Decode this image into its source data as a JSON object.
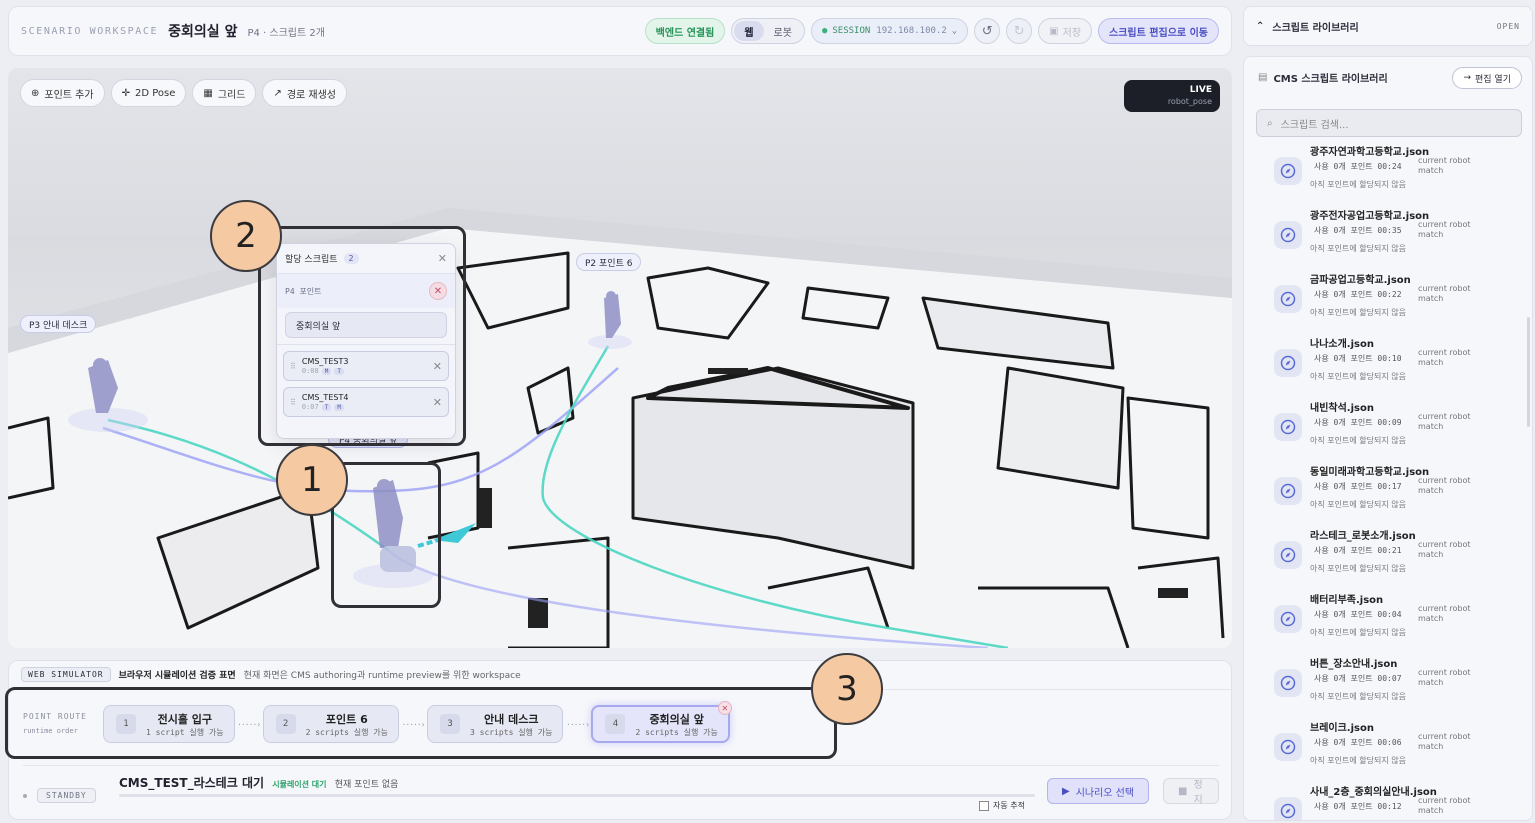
{
  "topbar": {
    "label": "SCENARIO WORKSPACE",
    "title": "중회의실 앞",
    "subtitle": "P4 · 스크립트 2개",
    "backend": "백엔드 연결됨",
    "mode_web": "웹",
    "mode_robot": "로봇",
    "session_label": "SESSION",
    "session_ip": "192.168.100.2",
    "save": "저장",
    "goto_edit": "스크립트 편집으로 이동"
  },
  "toolbar": {
    "add_point": "포인트 추가",
    "pose": "2D Pose",
    "grid": "그리드",
    "regen": "경로 재생성"
  },
  "live": {
    "title": "LIVE",
    "sub": "robot_pose"
  },
  "map_tags": {
    "p3": "P3  안내 데스크",
    "p2": "P2  포인트 6",
    "p4": "P4  중회의실 앞"
  },
  "assign_panel": {
    "title": "할당 스크립트",
    "count": "2",
    "point_label": "P4  포인트",
    "point_name": "중회의실 앞",
    "scripts": [
      {
        "name": "CMS_TEST3",
        "time": "0:08",
        "tags": [
          "M",
          "T"
        ]
      },
      {
        "name": "CMS_TEST4",
        "time": "0:07",
        "tags": [
          "T",
          "M"
        ]
      }
    ]
  },
  "callouts": [
    "1",
    "2",
    "3"
  ],
  "simulator": {
    "tag": "WEB SIMULATOR",
    "title": "브라우저 시뮬레이션 검증 표면",
    "desc": "현재 화면은 CMS authoring과 runtime preview를 위한 workspace"
  },
  "route": {
    "label": "POINT ROUTE",
    "sub": "runtime order",
    "steps": [
      {
        "n": "1",
        "title": "전시홀 입구",
        "desc": "1 script 실행 가능"
      },
      {
        "n": "2",
        "title": "포인트 6",
        "desc": "2 scripts 실행 가능"
      },
      {
        "n": "3",
        "title": "안내 데스크",
        "desc": "3 scripts 실행 가능"
      },
      {
        "n": "4",
        "title": "중회의실 앞",
        "desc": "2 scripts 실행 가능"
      }
    ]
  },
  "status": {
    "state": "STANDBY",
    "scenario": "CMS_TEST_라스테크 대기",
    "sim": "시뮬레이션 대기",
    "point": "현재 포인트 없음",
    "autotrack": "자동 추적",
    "select": "시나리오 선택",
    "stop": "정지"
  },
  "library": {
    "head": "스크립트 라이브러리",
    "open": "OPEN",
    "title": "CMS 스크립트 라이브러리",
    "edit": "편집 열기",
    "search_placeholder": "스크립트 검색...",
    "items": [
      {
        "name": "광주자연과학고등학교.json",
        "meta": "사용 0개 포인트  00:24",
        "cr1": "current robot",
        "cr2": "match",
        "note": "아직 포인트에 할당되지 않음"
      },
      {
        "name": "광주전자공업고등학교.json",
        "meta": "사용 0개 포인트  00:35",
        "cr1": "current robot",
        "cr2": "match",
        "note": "아직 포인트에 할당되지 않음"
      },
      {
        "name": "금파공업고등학교.json",
        "meta": "사용 0개 포인트  00:22",
        "cr1": "current robot",
        "cr2": "match",
        "note": "아직 포인트에 할당되지 않음"
      },
      {
        "name": "나나소개.json",
        "meta": "사용 0개 포인트  00:10",
        "cr1": "current robot",
        "cr2": "match",
        "note": "아직 포인트에 할당되지 않음"
      },
      {
        "name": "내빈착석.json",
        "meta": "사용 0개 포인트  00:09",
        "cr1": "current robot",
        "cr2": "match",
        "note": "아직 포인트에 할당되지 않음"
      },
      {
        "name": "동일미래과학고등학교.json",
        "meta": "사용 0개 포인트  00:17",
        "cr1": "current robot",
        "cr2": "match",
        "note": "아직 포인트에 할당되지 않음"
      },
      {
        "name": "라스테크_로봇소개.json",
        "meta": "사용 0개 포인트  00:21",
        "cr1": "current robot",
        "cr2": "match",
        "note": "아직 포인트에 할당되지 않음"
      },
      {
        "name": "배터리부족.json",
        "meta": "사용 0개 포인트  00:04",
        "cr1": "current robot",
        "cr2": "match",
        "note": "아직 포인트에 할당되지 않음"
      },
      {
        "name": "버튼_장소안내.json",
        "meta": "사용 0개 포인트  00:07",
        "cr1": "current robot",
        "cr2": "match",
        "note": "아직 포인트에 할당되지 않음"
      },
      {
        "name": "브레이크.json",
        "meta": "사용 0개 포인트  00:06",
        "cr1": "current robot",
        "cr2": "match",
        "note": "아직 포인트에 할당되지 않음"
      },
      {
        "name": "사내_2층_중회의실안내.json",
        "meta": "사용 0개 포인트  00:12",
        "cr1": "current robot",
        "cr2": "match",
        "note": ""
      }
    ]
  },
  "colors": {
    "accent": "#4b4fc4",
    "path_teal": "#3fd0c6",
    "path_purple": "#8b8ff5",
    "callout": "#f5c9a1"
  }
}
